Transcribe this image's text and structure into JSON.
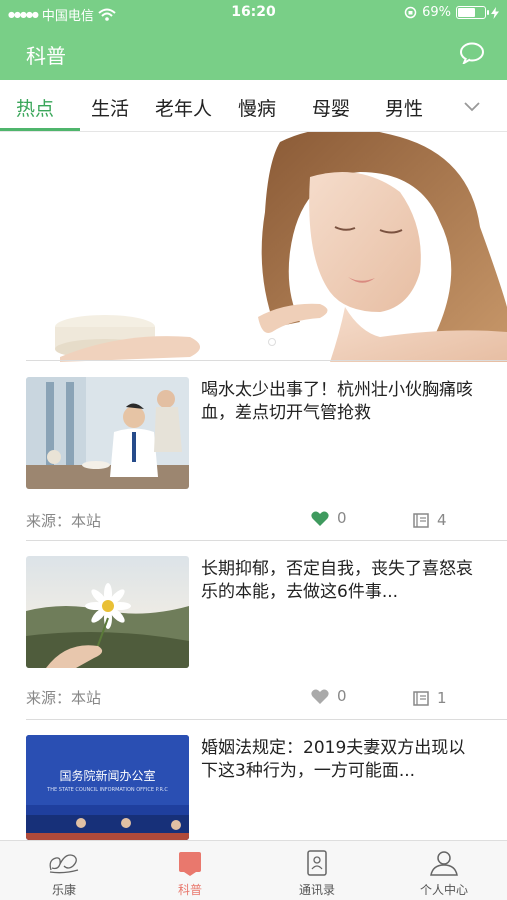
{
  "status_bar": {
    "carrier": "中国电信",
    "time": "16:20",
    "battery": "69%",
    "battery_level": 0.69,
    "icons": [
      "signal-dots-icon",
      "wifi-icon",
      "orientation-lock-icon",
      "battery-icon",
      "charging-icon"
    ]
  },
  "header": {
    "title": "科普",
    "icon": "chat-bubble-icon"
  },
  "tabs": {
    "items": [
      "热点",
      "生活",
      "老年人",
      "慢病",
      "母婴",
      "男性"
    ],
    "active_index": 0,
    "more_icon": "chevron-down-icon"
  },
  "banner": {
    "image": "woman-applying-cream-photo",
    "indicator_icon": "page-dot-icon"
  },
  "articles": [
    {
      "title": "喝水太少出事了！杭州壮小伙胸痛咳血，差点切开气管抢救",
      "source": "来源：本站",
      "likes": "0",
      "reads": "4",
      "thumb": "man-with-headache-photo",
      "liked": true
    },
    {
      "title": "长期抑郁，否定自我，丧失了喜怒哀乐的本能，去做这6件事...",
      "source": "来源：本站",
      "likes": "0",
      "reads": "1",
      "thumb": "hand-holding-daisy-photo",
      "liked": false
    },
    {
      "title": "婚姻法规定：2019夫妻双方出现以下这3种行为，一方可能面...",
      "thumb": "press-conference-photo",
      "thumb_caption": "国务院新闻办公室",
      "thumb_caption_en": "THE STATE COUNCIL INFORMATION OFFICE P.R.C"
    }
  ],
  "bottom_nav": {
    "items": [
      {
        "label": "乐康",
        "icon": "lekang-logo-icon"
      },
      {
        "label": "科普",
        "icon": "article-icon"
      },
      {
        "label": "通讯录",
        "icon": "contacts-icon"
      },
      {
        "label": "个人中心",
        "icon": "person-icon"
      }
    ],
    "active_index": 1
  },
  "colors": {
    "header_green": "#79cf87",
    "active_tab": "#3aa65a",
    "nav_active": "#e9786d",
    "liked_heart": "#3f9a5e"
  }
}
